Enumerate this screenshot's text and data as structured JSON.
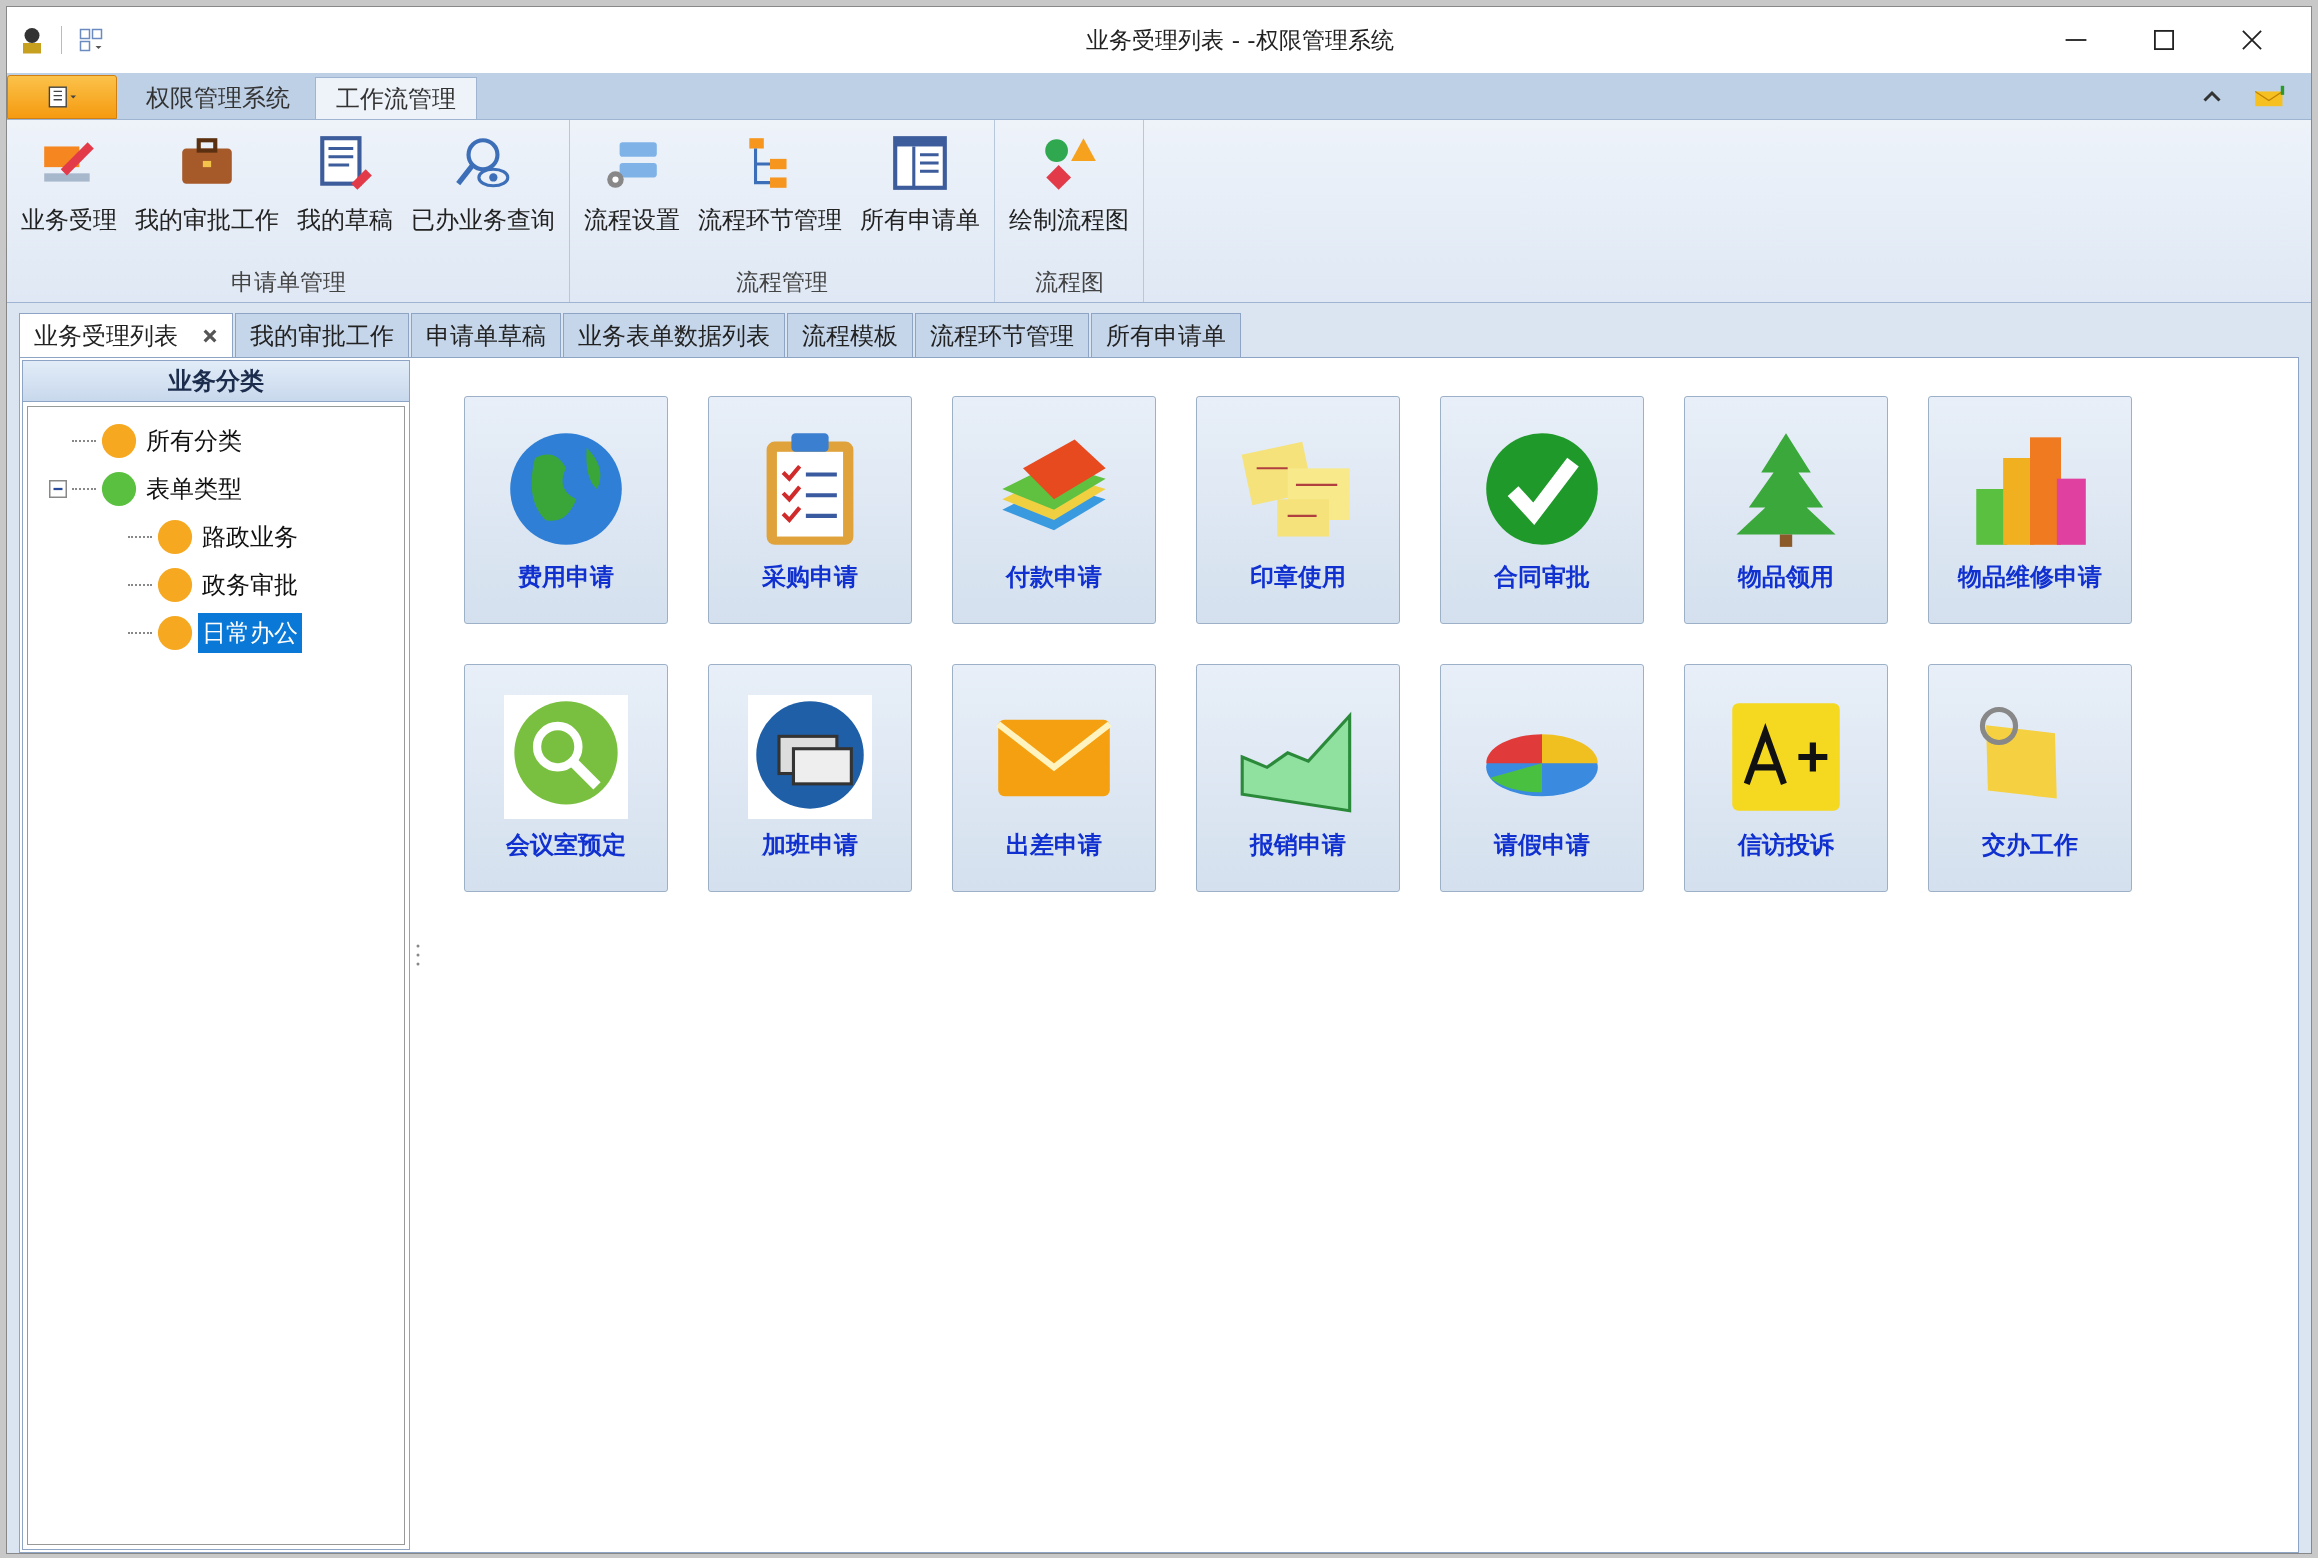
{
  "window": {
    "title": "业务受理列表 - -权限管理系统"
  },
  "ribbon_tabs": [
    {
      "label": "权限管理系统",
      "selected": false
    },
    {
      "label": "工作流管理",
      "selected": true
    }
  ],
  "ribbon_groups": [
    {
      "label": "申请单管理",
      "buttons": [
        "业务受理",
        "我的审批工作",
        "我的草稿",
        "已办业务查询"
      ]
    },
    {
      "label": "流程管理",
      "buttons": [
        "流程设置",
        "流程环节管理",
        "所有申请单"
      ]
    },
    {
      "label": "流程图",
      "buttons": [
        "绘制流程图"
      ]
    }
  ],
  "document_tabs": [
    {
      "label": "业务受理列表",
      "selected": true,
      "closable": true
    },
    {
      "label": "我的审批工作",
      "selected": false,
      "closable": false
    },
    {
      "label": "申请单草稿",
      "selected": false,
      "closable": false
    },
    {
      "label": "业务表单数据列表",
      "selected": false,
      "closable": false
    },
    {
      "label": "流程模板",
      "selected": false,
      "closable": false
    },
    {
      "label": "流程环节管理",
      "selected": false,
      "closable": false
    },
    {
      "label": "所有申请单",
      "selected": false,
      "closable": false
    }
  ],
  "sidebar": {
    "title": "业务分类",
    "tree": [
      {
        "label": "所有分类",
        "selected": false
      },
      {
        "label": "表单类型",
        "selected": false,
        "expanded": true,
        "children": [
          {
            "label": "路政业务",
            "selected": false
          },
          {
            "label": "政务审批",
            "selected": false
          },
          {
            "label": "日常办公",
            "selected": true
          }
        ]
      }
    ]
  },
  "tiles": [
    "费用申请",
    "采购申请",
    "付款申请",
    "印章使用",
    "合同审批",
    "物品领用",
    "物品维修申请",
    "会议室预定",
    "加班申请",
    "出差申请",
    "报销申请",
    "请假申请",
    "信访投诉",
    "交办工作"
  ]
}
